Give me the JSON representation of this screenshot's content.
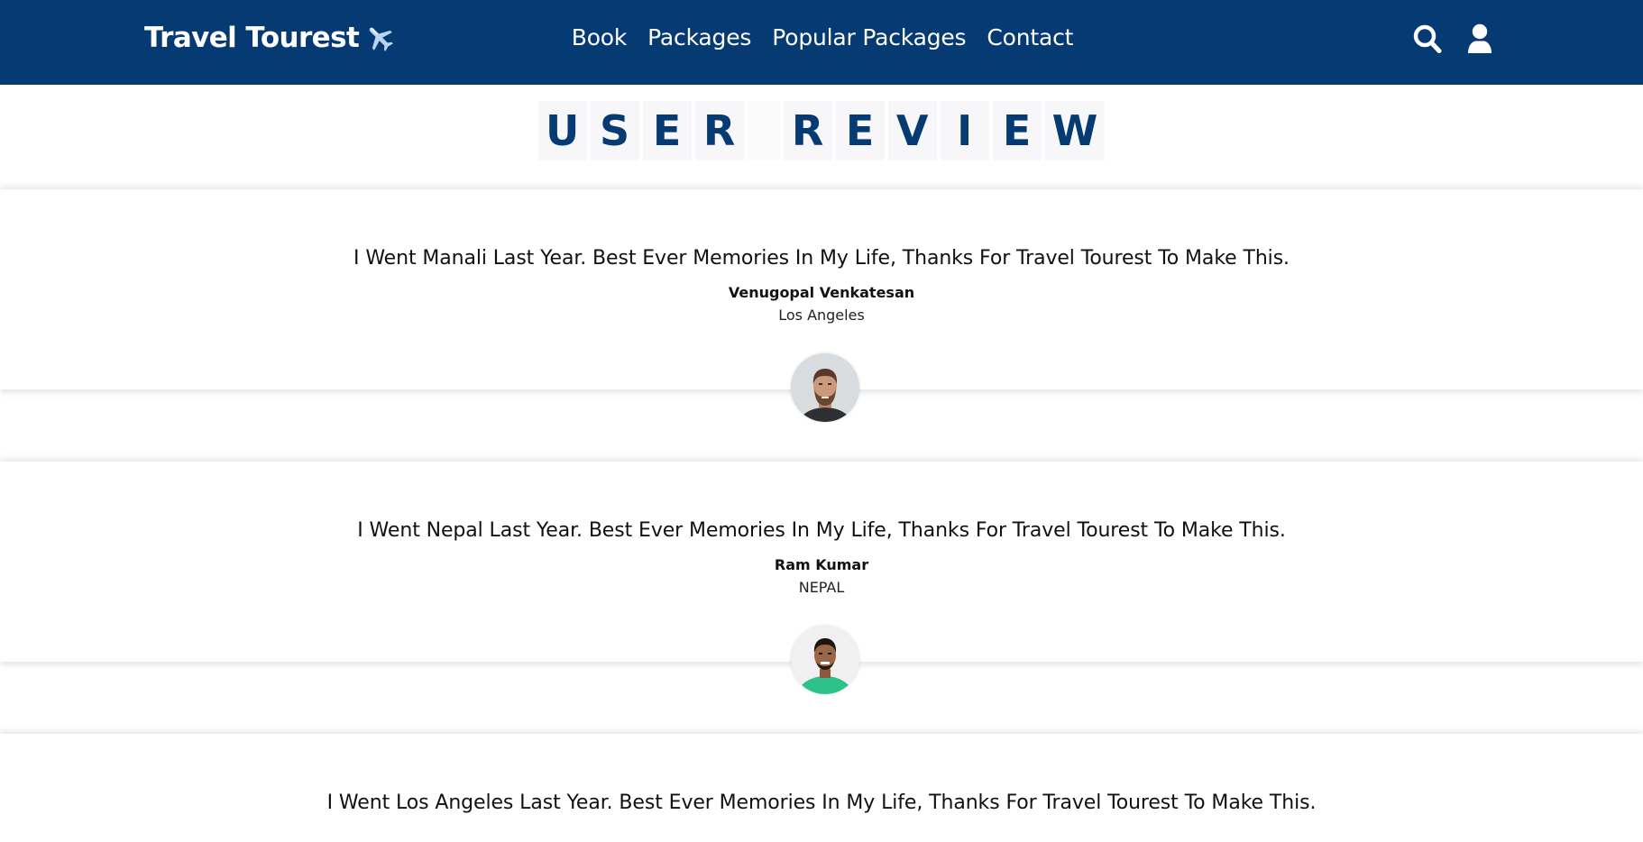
{
  "header": {
    "logo_text": "Travel Tourest",
    "nav": [
      {
        "label": "Book"
      },
      {
        "label": "Packages"
      },
      {
        "label": "Popular Packages"
      },
      {
        "label": "Contact"
      }
    ],
    "icons": [
      "search-icon",
      "user-icon"
    ],
    "background": "#063a72"
  },
  "section": {
    "title_letters": [
      "U",
      "S",
      "E",
      "R",
      " ",
      "R",
      "E",
      "V",
      "I",
      "E",
      "W"
    ],
    "title_color": "#063a72"
  },
  "reviews": [
    {
      "text": "I Went Manali Last Year. Best Ever Memories In My Life, Thanks For Travel Tourest To Make This.",
      "name": "Venugopal Venkatesan",
      "location": "Los Angeles"
    },
    {
      "text": "I Went Nepal Last Year. Best Ever Memories In My Life, Thanks For Travel Tourest To Make This.",
      "name": "Ram Kumar",
      "location": "NEPAL"
    },
    {
      "text": "I Went Los Angeles Last Year. Best Ever Memories In My Life, Thanks For Travel Tourest To Make This."
    }
  ]
}
